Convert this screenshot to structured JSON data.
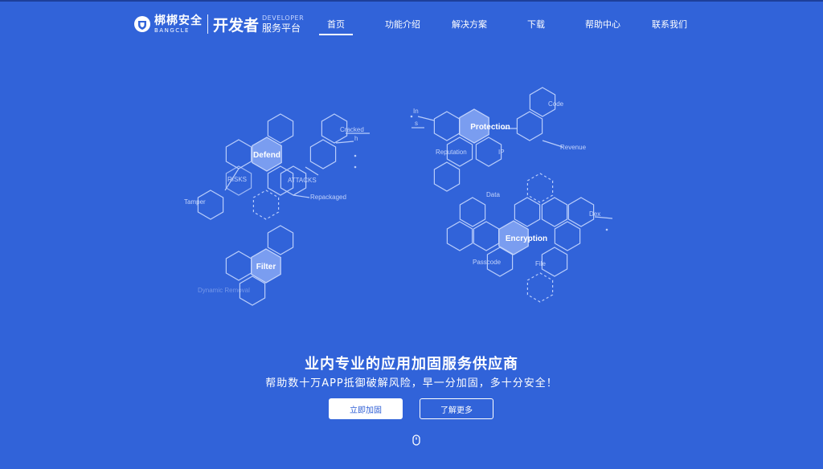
{
  "header": {
    "brand_cn": "梆梆安全",
    "brand_en": "BANGCLE",
    "dev_cn": "开发者",
    "dev_en": "DEVELOPER",
    "dev_sub": "服务平台"
  },
  "nav": [
    {
      "label": "首页",
      "active": true
    },
    {
      "label": "功能介绍",
      "active": false
    },
    {
      "label": "解决方案",
      "active": false
    },
    {
      "label": "下载",
      "active": false
    },
    {
      "label": "帮助中心",
      "active": false
    },
    {
      "label": "联系我们",
      "active": false
    }
  ],
  "illustration": {
    "defend": {
      "hub": "Defend",
      "labels": [
        "Cracked",
        "h",
        "RISKS",
        "ATTACKS",
        "Tamper",
        "Repackaged"
      ]
    },
    "protection": {
      "hub": "Protection",
      "labels": [
        "In",
        "s",
        "Reputation",
        "IP",
        "Code",
        "Revenue"
      ]
    },
    "encryption": {
      "hub": "Encryption",
      "labels": [
        "Data",
        "Dex",
        "Passcode",
        "File"
      ]
    },
    "filter": {
      "hub": "Filter",
      "labels": [
        "Dynamic Removal"
      ]
    }
  },
  "hero": {
    "title": "业内专业的应用加固服务供应商",
    "subtitle": "帮助数十万APP抵御破解风险，早一分加固，多十分安全！",
    "primary_button": "立即加固",
    "secondary_button": "了解更多"
  },
  "colors": {
    "background": "#3163d9",
    "hex_stroke": "#b9cdfb",
    "hex_hub": "#7a9df0",
    "primary_text": "#2f5fd6"
  }
}
